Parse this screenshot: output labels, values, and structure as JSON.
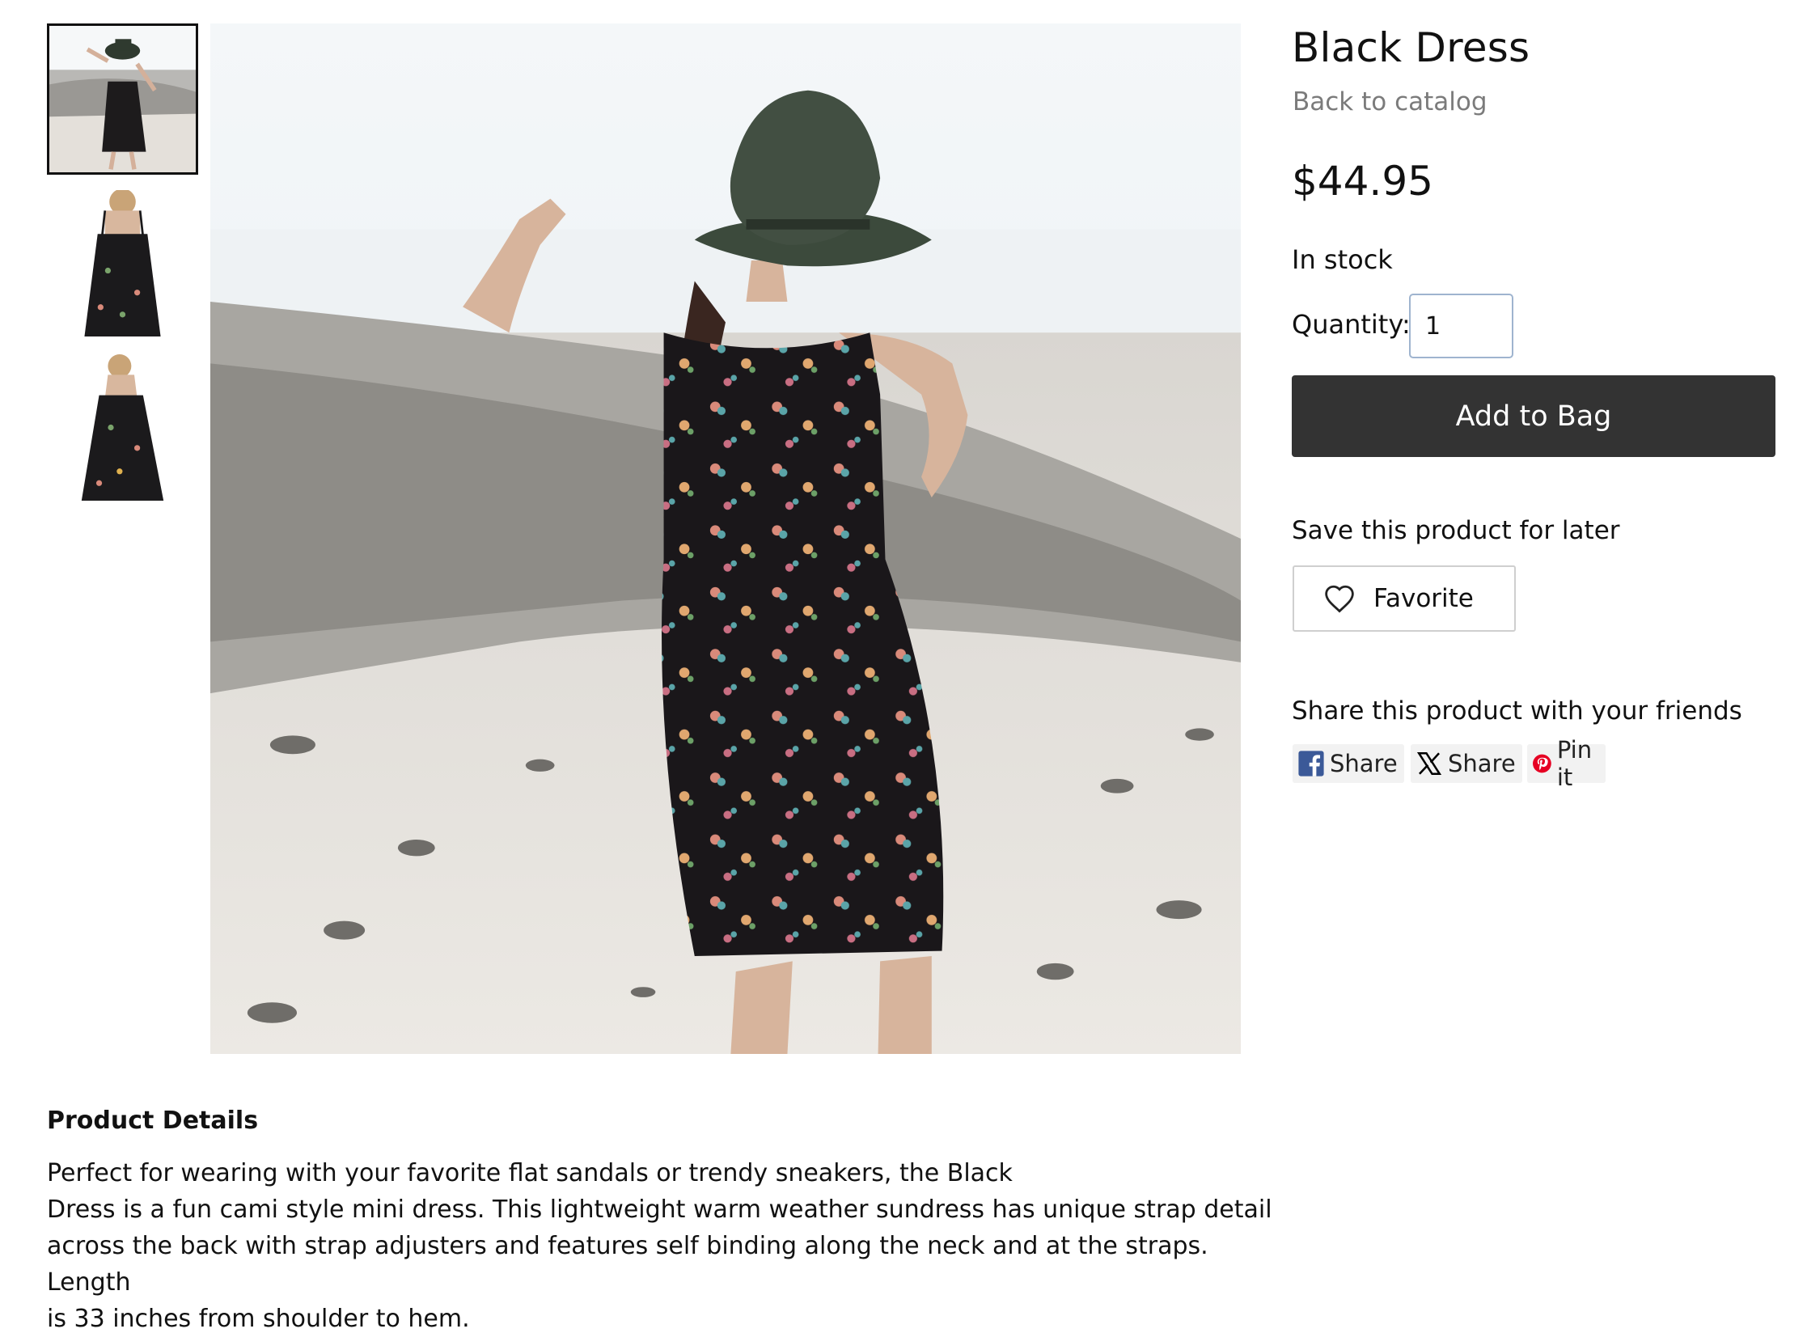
{
  "product": {
    "title": "Black Dress",
    "back_link": "Back to catalog",
    "price": "$44.95",
    "stock_status": "In stock",
    "quantity_label": "Quantity:",
    "quantity_value": "1",
    "add_to_bag_label": "Add to Bag"
  },
  "gallery": {
    "thumbnails": [
      {
        "icon": "beach-dress-photo",
        "active": true
      },
      {
        "icon": "dress-back-photo",
        "active": false
      },
      {
        "icon": "dress-front-photo",
        "active": false
      }
    ],
    "main_image": "beach-dress-photo"
  },
  "save": {
    "label": "Save this product for later",
    "favorite_label": "Favorite",
    "icon": "heart-icon"
  },
  "share": {
    "label": "Share this product with your friends",
    "buttons": [
      {
        "label": "Share",
        "icon": "facebook-icon",
        "color": "#3b5998"
      },
      {
        "label": "Share",
        "icon": "x-icon",
        "color": "#000000"
      },
      {
        "label": "Pin it",
        "icon": "pinterest-icon",
        "color": "#e60023"
      }
    ]
  },
  "details": {
    "heading": "Product Details",
    "lines": [
      "Perfect for wearing with your favorite flat sandals or trendy sneakers, the Black",
      "Dress is a fun cami style mini dress. This lightweight warm weather sundress has unique strap detail",
      "across the back with strap adjusters and features self binding along the neck and at the straps.",
      "Length",
      "is 33 inches from shoulder to hem."
    ]
  },
  "colors": {
    "button_dark": "#333333",
    "muted_text": "#7b7b7b",
    "input_border": "#9fb4cf"
  }
}
